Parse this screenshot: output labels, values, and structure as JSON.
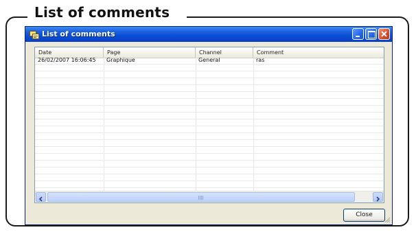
{
  "frame": {
    "title": "List of comments"
  },
  "window": {
    "title": "List of comments",
    "icon": "app-icon",
    "controls": [
      "minimize",
      "maximize",
      "close"
    ]
  },
  "listview": {
    "columns": [
      "Date",
      "Page",
      "Channel",
      "Comment"
    ],
    "rows": [
      {
        "date": "26/02/2007 16:06:45",
        "page": "Graphique",
        "channel": "General",
        "comment": "ras"
      }
    ]
  },
  "buttons": {
    "close": "Close"
  },
  "colors": {
    "titlebar": "#0a4ed6",
    "close_button": "#d94a2a",
    "window_bg": "#ece9d8"
  }
}
